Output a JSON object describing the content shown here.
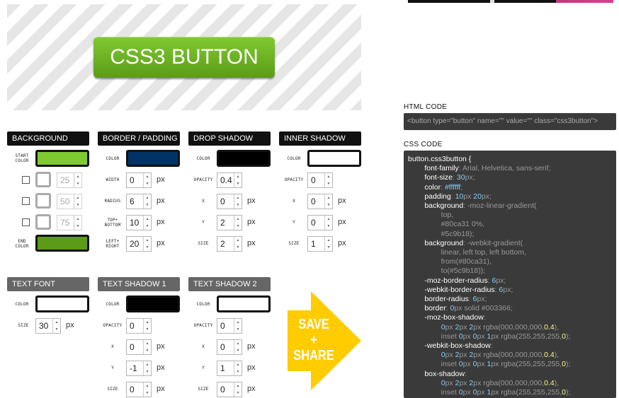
{
  "preview": {
    "button_label": "CSS3 BUTTON"
  },
  "sections": {
    "background": "BACKGROUND",
    "border_padding": "BORDER / PADDING",
    "drop_shadow": "DROP SHADOW",
    "inner_shadow": "INNER SHADOW",
    "text_font": "TEXT FONT",
    "text_shadow1": "TEXT SHADOW 1",
    "text_shadow2": "TEXT SHADOW 2"
  },
  "labels": {
    "start_color_1": "START",
    "start_color_2": "COLOR",
    "end_color_1": "END",
    "end_color_2": "COLOR",
    "color": "COLOR",
    "width": "WIDTH",
    "radius": "RADIUS",
    "top_bottom_1": "TOP+",
    "top_bottom_2": "BOTTOM",
    "left_right_1": "LEFT+",
    "left_right_2": "RIGHT",
    "opacity": "OPACITY",
    "x": "X",
    "y": "Y",
    "size": "SIZE",
    "px": "px"
  },
  "background": {
    "start_color": "#80ca31",
    "end_color": "#5c9b18",
    "stop1": "25",
    "stop2": "50",
    "stop3": "75"
  },
  "border": {
    "color": "#003366",
    "width": "0",
    "radius": "6",
    "top_bottom": "10",
    "left_right": "20"
  },
  "drop_shadow": {
    "color": "#000000",
    "opacity": "0.4",
    "x": "0",
    "y": "2",
    "size": "2"
  },
  "inner_shadow": {
    "color": "#ffffff",
    "opacity": "0",
    "x": "0",
    "y": "0",
    "size": "1"
  },
  "text_font": {
    "color": "#ffffff",
    "size": "30"
  },
  "text_shadow1": {
    "color": "#000000",
    "opacity": "0",
    "x": "0",
    "y": "-1",
    "size": "0"
  },
  "text_shadow2": {
    "color": "#ffffff",
    "opacity": "0",
    "x": "0",
    "y": "1",
    "size": "0"
  },
  "save": {
    "line1": "SAVE",
    "line2": "+",
    "line3": "SHARE",
    "color": "#ffcc00"
  },
  "code": {
    "html_title": "HTML CODE",
    "html_code": "<button type=\"button\" name=\"\" value=\"\" class=\"css3button\">",
    "css_title": "CSS CODE"
  }
}
